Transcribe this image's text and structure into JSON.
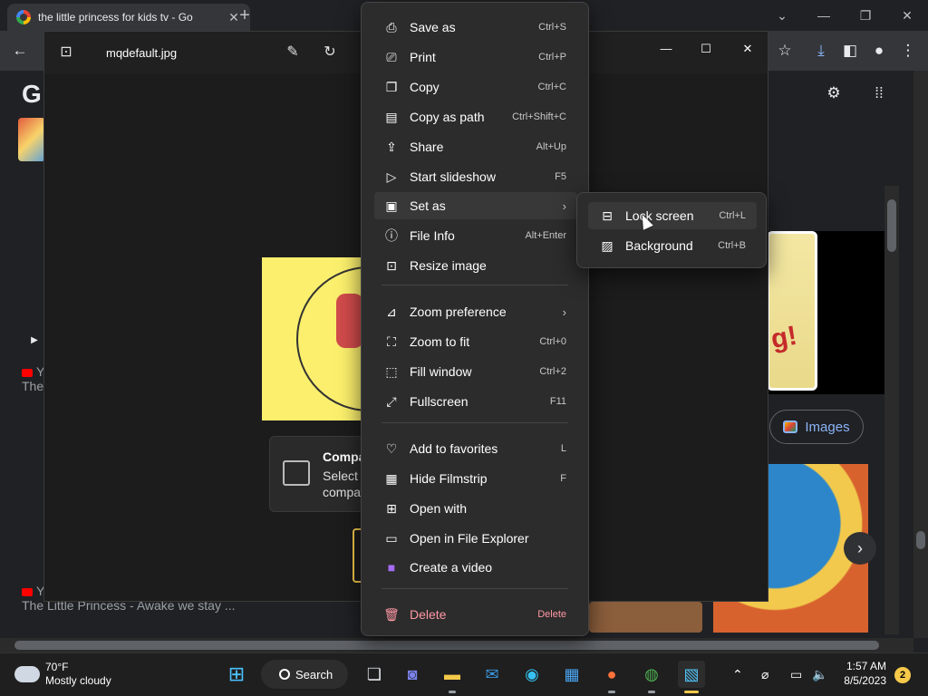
{
  "browser": {
    "tab_title": "the little princess for kids tv - Go",
    "tab_close": "✕",
    "new_tab": "+",
    "window_min": "—",
    "window_max": "❐",
    "window_close": "✕"
  },
  "page": {
    "logo_letter": "G",
    "yt_rows": [
      {
        "prefix": "Y",
        "text": "The"
      },
      {
        "prefix": "Y",
        "text": "The Little Princess - Awake we stay ..."
      }
    ],
    "images_chip": "Images",
    "handwriting": "g!"
  },
  "photos": {
    "filename": "mqdefault.jpg",
    "compare_title": "Compa",
    "compare_sub": "Select compa",
    "ctl_min": "—",
    "ctl_max": "☐",
    "ctl_close": "✕"
  },
  "context_menu": {
    "items": [
      {
        "label": "Save as",
        "key": "Ctrl+S",
        "icon": "save-icon"
      },
      {
        "label": "Print",
        "key": "Ctrl+P",
        "icon": "print-icon"
      },
      {
        "label": "Copy",
        "key": "Ctrl+C",
        "icon": "copy-icon"
      },
      {
        "label": "Copy as path",
        "key": "Ctrl+Shift+C",
        "icon": "copy-path-icon"
      },
      {
        "label": "Share",
        "key": "Alt+Up",
        "icon": "share-icon"
      },
      {
        "label": "Start slideshow",
        "key": "F5",
        "icon": "slideshow-icon"
      },
      {
        "label": "Set as",
        "key": "",
        "icon": "set-as-icon"
      },
      {
        "label": "File Info",
        "key": "Alt+Enter",
        "icon": "info-icon"
      },
      {
        "label": "Resize image",
        "key": "",
        "icon": "resize-icon"
      },
      {
        "label": "Zoom preference",
        "key": "",
        "icon": "zoom-pref-icon"
      },
      {
        "label": "Zoom to fit",
        "key": "Ctrl+0",
        "icon": "zoom-fit-icon"
      },
      {
        "label": "Fill window",
        "key": "Ctrl+2",
        "icon": "fill-window-icon"
      },
      {
        "label": "Fullscreen",
        "key": "F11",
        "icon": "fullscreen-icon"
      },
      {
        "label": "Add to favorites",
        "key": "L",
        "icon": "heart-icon"
      },
      {
        "label": "Hide Filmstrip",
        "key": "F",
        "icon": "filmstrip-icon"
      },
      {
        "label": "Open with",
        "key": "",
        "icon": "open-with-icon"
      },
      {
        "label": "Open in File Explorer",
        "key": "",
        "icon": "folder-icon"
      },
      {
        "label": "Create a video",
        "key": "",
        "icon": "video-icon"
      },
      {
        "label": "Delete",
        "key": "Delete",
        "icon": "trash-icon"
      }
    ]
  },
  "submenu": {
    "items": [
      {
        "label": "Lock screen",
        "key": "Ctrl+L",
        "icon": "lock-screen-icon"
      },
      {
        "label": "Background",
        "key": "Ctrl+B",
        "icon": "background-icon"
      }
    ]
  },
  "taskbar": {
    "weather_temp": "70°F",
    "weather_desc": "Mostly cloudy",
    "search_label": "Search",
    "time": "1:57 AM",
    "date": "8/5/2023",
    "notification_count": "2"
  },
  "colors": {
    "accent": "#8ab4f8",
    "menu_bg": "#2c2c2c",
    "delete": "#ff99a4",
    "taskbar_active": "#f6c94a"
  }
}
